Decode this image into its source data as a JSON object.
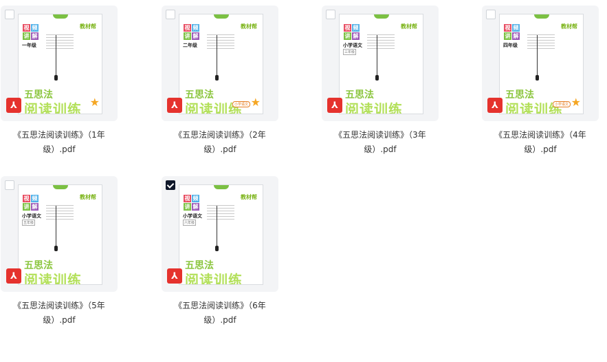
{
  "files": [
    {
      "name": "《五思法阅读训练》（1年级）.pdf",
      "checked": false,
      "cover": {
        "logo": [
          "视",
          "频",
          "讲",
          "解"
        ],
        "grade": "一年级",
        "sub": "",
        "brand": "教材帮",
        "title1": "五思法",
        "title2": "阅读训练",
        "pill": "",
        "star": "★"
      }
    },
    {
      "name": "《五思法阅读训练》（2年级）.pdf",
      "checked": false,
      "cover": {
        "logo": [
          "视",
          "频",
          "讲",
          "解"
        ],
        "grade": "二年级",
        "sub": "",
        "brand": "教材帮",
        "title1": "五思法",
        "title2": "阅读训练",
        "pill": "小学语文",
        "star": "★"
      }
    },
    {
      "name": "《五思法阅读训练》（3年级）.pdf",
      "checked": false,
      "cover": {
        "logo": [
          "视",
          "频",
          "讲",
          "解"
        ],
        "grade": "小学语文",
        "sub": "三年级",
        "brand": "教材帮",
        "title1": "五思法",
        "title2": "阅读训练",
        "pill": "",
        "star": ""
      }
    },
    {
      "name": "《五思法阅读训练》（4年级）.pdf",
      "checked": false,
      "cover": {
        "logo": [
          "视",
          "频",
          "讲",
          "解"
        ],
        "grade": "四年级",
        "sub": "",
        "brand": "教材帮",
        "title1": "五思法",
        "title2": "阅读训练",
        "pill": "小学语文",
        "star": "★"
      }
    },
    {
      "name": "《五思法阅读训练》（5年级）.pdf",
      "checked": false,
      "cover": {
        "logo": [
          "视",
          "频",
          "讲",
          "解"
        ],
        "grade": "小学语文",
        "sub": "五年级",
        "brand": "教材帮",
        "title1": "五思法",
        "title2": "阅读训练",
        "pill": "",
        "star": ""
      }
    },
    {
      "name": "《五思法阅读训练》（6年级）.pdf",
      "checked": true,
      "cover": {
        "logo": [
          "视",
          "频",
          "讲",
          "解"
        ],
        "grade": "小学语文",
        "sub": "六年级",
        "brand": "教材帮",
        "title1": "五思法",
        "title2": "阅读训练",
        "pill": "",
        "star": ""
      }
    }
  ],
  "icons": {
    "file_type": "pdf-icon"
  },
  "colors": {
    "pdf": "#e5322d",
    "checked": "#0f172a",
    "tile_bg": "#f3f4f6",
    "accent": "#8cc63f"
  }
}
